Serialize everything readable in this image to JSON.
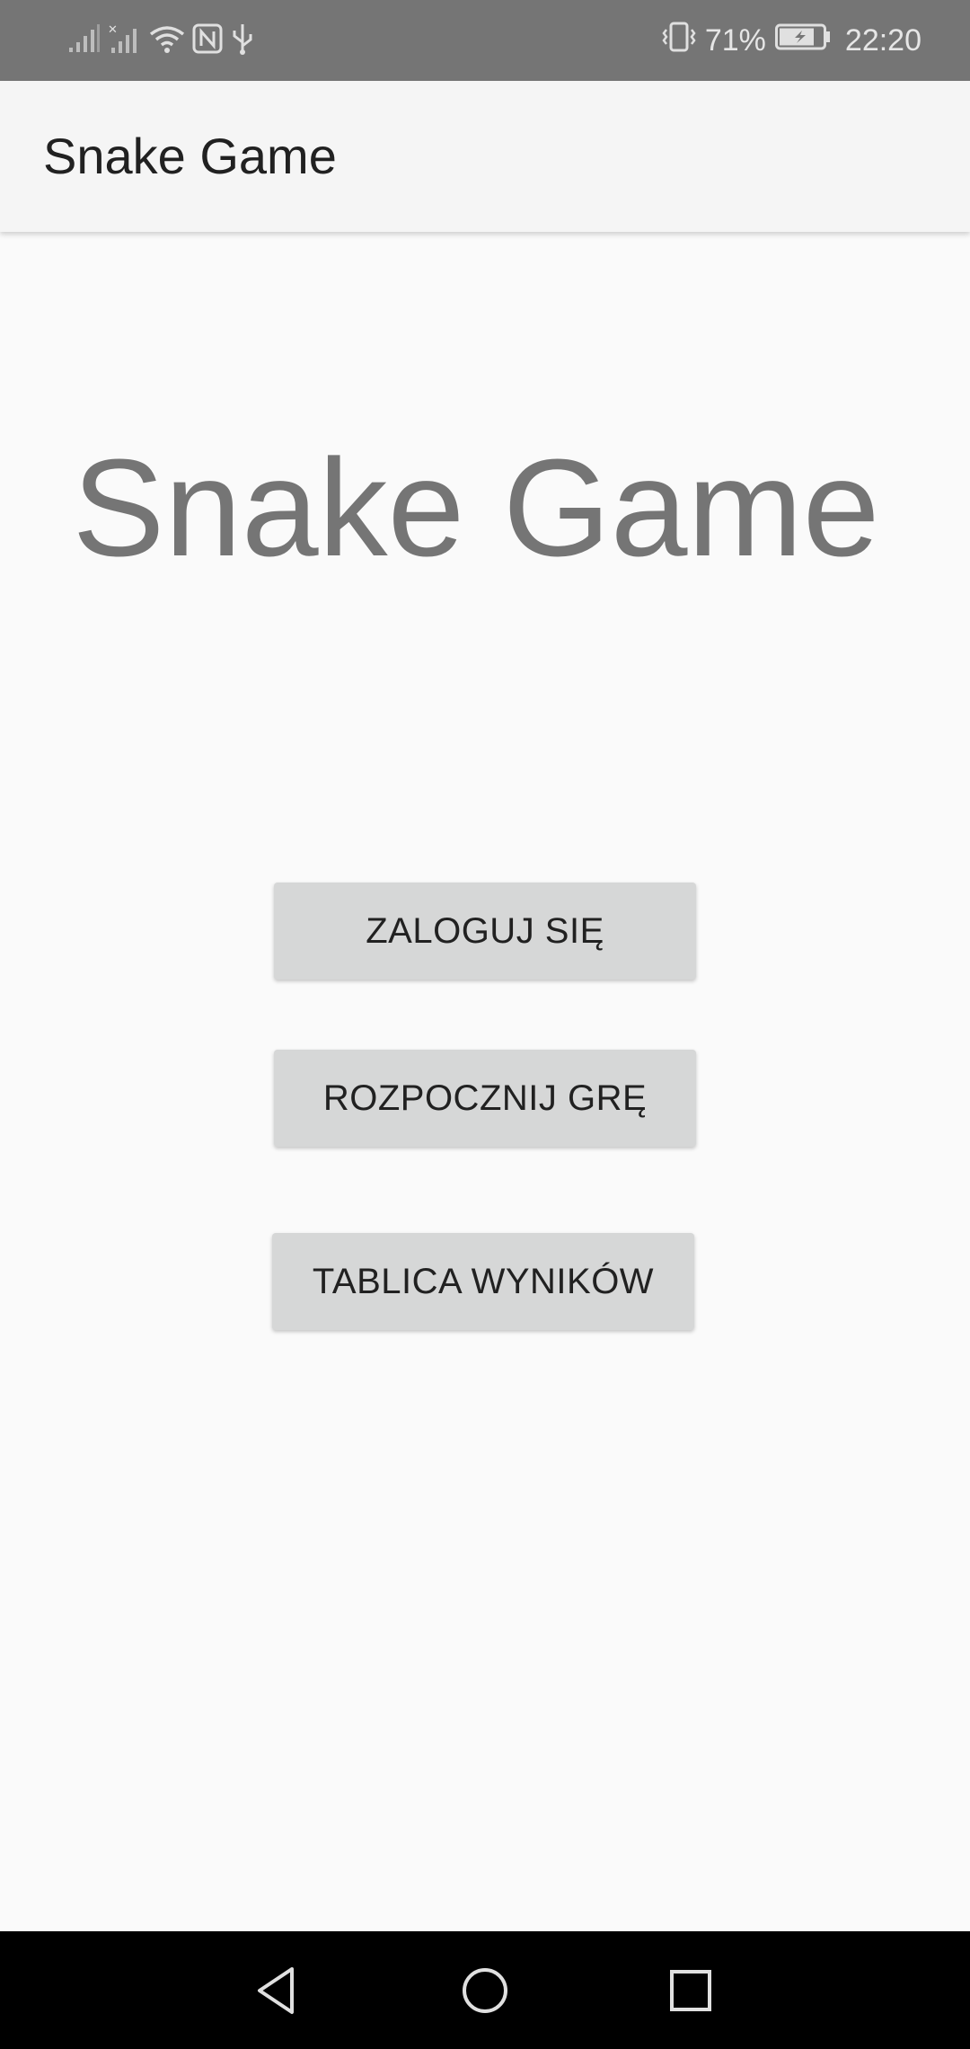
{
  "status_bar": {
    "battery_percent": "71%",
    "time": "22:20",
    "icons": [
      "signal-icon",
      "no-signal-icon",
      "wifi-icon",
      "nfc-icon",
      "usb-icon",
      "vibrate-icon",
      "battery-charging-icon"
    ]
  },
  "app_bar": {
    "title": "Snake Game"
  },
  "main": {
    "title": "Snake Game",
    "buttons": {
      "login": "ZALOGUJ SIĘ",
      "start": "ROZPOCZNIJ GRĘ",
      "scoreboard": "TABLICA WYNIKÓW"
    }
  },
  "nav_bar": {
    "icons": [
      "back-icon",
      "home-icon",
      "recents-icon"
    ]
  },
  "colors": {
    "status_bar": "#757575",
    "app_bar": "#f5f5f5",
    "background": "#fafafa",
    "button": "#d6d7d7",
    "title_text": "#757575",
    "nav_bar": "#000000"
  }
}
